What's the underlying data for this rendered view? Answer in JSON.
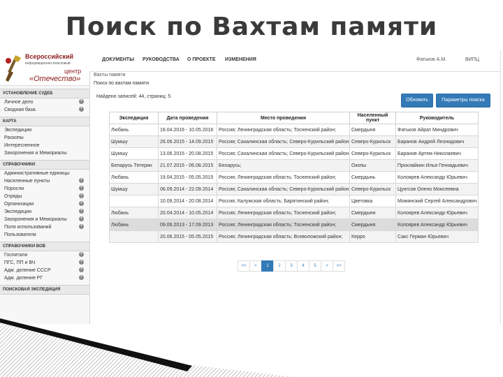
{
  "slide_title": "Поиск по Вахтам памяти",
  "logo": {
    "line1": "Всероссийский",
    "line2": "информационно-поисковый",
    "line3": "центр",
    "line4": "«Отечество»"
  },
  "sidebar": {
    "sections": [
      {
        "title": "УСТАНОВЛЕНИЕ СУДЕБ",
        "items": [
          {
            "label": "Личное дело",
            "plus": true
          },
          {
            "label": "Сводная база",
            "plus": true
          }
        ]
      },
      {
        "title": "КАРТА",
        "items": [
          {
            "label": "Экспедиции",
            "plus": false
          },
          {
            "label": "Раскопы",
            "plus": false
          },
          {
            "label": "Интересненное",
            "plus": false
          },
          {
            "label": "Захоронения и Мемориалы",
            "plus": false
          }
        ]
      },
      {
        "title": "СПРАВОЧНИКИ",
        "items": [
          {
            "label": "Административные единицы",
            "plus": false
          },
          {
            "label": "Населенные пункты",
            "plus": true
          },
          {
            "label": "Поросли",
            "plus": true
          },
          {
            "label": "Отряды",
            "plus": true
          },
          {
            "label": "Организации",
            "plus": true
          },
          {
            "label": "Экспедиции",
            "plus": true
          },
          {
            "label": "Захоронения и Мемориалы",
            "plus": true
          },
          {
            "label": "Поля использований",
            "plus": true
          },
          {
            "label": "Пользователи",
            "plus": false
          }
        ]
      },
      {
        "title": "СПРАВОЧНИКИ ВОВ",
        "items": [
          {
            "label": "Госпитали",
            "plus": true
          },
          {
            "label": "ПГС, ПП и ВЧ",
            "plus": true
          },
          {
            "label": "Адм. деление СССР",
            "plus": true
          },
          {
            "label": "Адм. деление РГ",
            "plus": true
          }
        ]
      },
      {
        "title": "ПОИСКОВАЯ ЭКСПЕДИЦИЯ",
        "items": []
      }
    ]
  },
  "topnav": {
    "items": [
      "ДОКУМЕНТЫ",
      "РУКОВОДСТВА",
      "О ПРОЕКТЕ",
      "ИЗМЕНЕНИЯ"
    ],
    "user": "Фатьков А.М.",
    "org": "ВИПЦ"
  },
  "breadcrumb": "Вахты памяти",
  "subtitle": "Поиск по вахтам памяти",
  "found_text": "Найдено записей: 44, страниц: 5",
  "buttons": {
    "refresh": "Обновить",
    "params": "Параметры поиска"
  },
  "table": {
    "columns": [
      "Экспедиция",
      "Дата проведения",
      "Место проведения",
      "Населенный пункт",
      "Руководитель"
    ],
    "rows": [
      {
        "exp": "Любань",
        "date": "18.04.2016 - 10.05.2016",
        "place": "Россия; Ленинградская область; Тосненский район;",
        "locality": "Смердыня",
        "leader": "Фатьков Айрат Миндрович"
      },
      {
        "exp": "Шумшу",
        "date": "26.06.2015 - 14.09.2015",
        "place": "Россия; Сахалинская область; Северо-Курильский район;",
        "locality": "Северо-Курильск",
        "leader": "Баранов Андрей Леонидович"
      },
      {
        "exp": "Шумшу",
        "date": "13.06.2015 - 20.08.2015",
        "place": "Россия; Сахалинская область; Северо-Курильский район;",
        "locality": "Северо-Курильск",
        "leader": "Баранов Артем Николаевич"
      },
      {
        "exp": "Беларусь Тетерин",
        "date": "21.07.2015 - 06.08.2015",
        "place": "Беларусь;",
        "locality": "Окопы",
        "leader": "Проклайкин Илья Геннадьевич"
      },
      {
        "exp": "Любань",
        "date": "19.04.2015 - 05.05.2015",
        "place": "Россия; Ленинградская область; Тосненский район;",
        "locality": "Смердынь",
        "leader": "Колоярев Александр Юрьевич"
      },
      {
        "exp": "Шумшу",
        "date": "06.09.2014 - 22.09.2014",
        "place": "Россия; Сахалинская область; Северо-Курильский район;",
        "locality": "Северо-Курильск",
        "leader": "Цунгсов Олено Моисеевна"
      },
      {
        "exp": "",
        "date": "10.09.2014 - 20.08.2014",
        "place": "Россия; Калужская область; Барятинский район;",
        "locality": "Цветовка",
        "leader": "Момянский Сергей Александрович"
      },
      {
        "exp": "Любань",
        "date": "20.04.2014 - 10.05.2014",
        "place": "Россия; Ленинградская область; Тосненский район;",
        "locality": "Смердыня",
        "leader": "Колоярев Александр Юрьевич"
      },
      {
        "exp": "Любань",
        "date": "09.06.2013 - 17.09.2013",
        "place": "Россия; Ленинградская область; Тосненский район;",
        "locality": "Смердыня",
        "leader": "Колоярев Александр Юрьевич"
      },
      {
        "exp": "",
        "date": "20.06.2015 - 05.05.2015",
        "place": "Россия; Ленинградская область; Всеволожский район;",
        "locality": "Керро",
        "leader": "Сакс Герман Юрьевич"
      }
    ],
    "selected_row": 8
  },
  "pagination": [
    "<<",
    "<",
    "1",
    "2",
    "3",
    "4",
    "5",
    ">",
    ">>"
  ],
  "pagination_active": "1"
}
